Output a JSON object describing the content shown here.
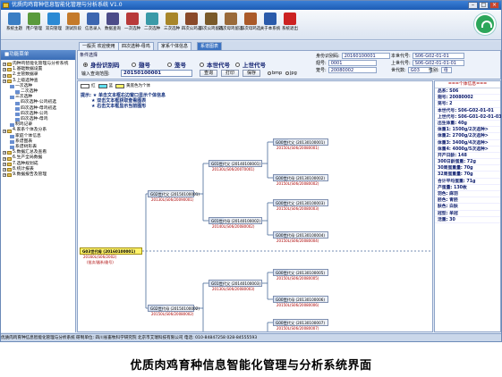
{
  "window": {
    "title": "优质肉鸡育种信息智能化管理与分析系统 V1.0"
  },
  "toolbar": [
    {
      "label": "系统主题",
      "color": "#3a7ec4",
      "icon": "theme-icon"
    },
    {
      "label": "用户管理",
      "color": "#5a9a3c",
      "icon": "users-icon"
    },
    {
      "label": "双向管理",
      "color": "#2c8ad4",
      "icon": "swap-icon"
    },
    {
      "label": "测试阶段",
      "color": "#c47a2a",
      "icon": "test-icon"
    },
    {
      "label": "信息录入",
      "color": "#3c66b0",
      "icon": "entry-icon"
    },
    {
      "label": "数据查询",
      "color": "#4c4c88",
      "icon": "query-icon"
    },
    {
      "label": "一次选种",
      "color": "#b83a3a",
      "icon": "select1-icon"
    },
    {
      "label": "二次选种",
      "color": "#3a9aa8",
      "icon": "select2-icon"
    },
    {
      "label": "三次选种",
      "color": "#a8862a",
      "icon": "select3-icon"
    },
    {
      "label": "四次公鸡选",
      "color": "#8a4a2a",
      "icon": "rooster-icon"
    },
    {
      "label": "四次公鸡留选",
      "color": "#7a5a2a",
      "icon": "rooster2-icon"
    },
    {
      "label": "四次母鸡留选",
      "color": "#9a6a3a",
      "icon": "hen-icon"
    },
    {
      "label": "四次母鸡选",
      "color": "#aa5a2a",
      "icon": "hen2-icon"
    },
    {
      "label": "关于本系统",
      "color": "#2a5aaa",
      "icon": "about-icon"
    },
    {
      "label": "系统退出",
      "color": "#cc2222",
      "icon": "exit-icon"
    }
  ],
  "tabs": [
    "一般页 欢迎使用",
    "四次选种-母鸡",
    "家系个体信息",
    "系谱图表"
  ],
  "sidebar": {
    "title": "■功能菜单",
    "items": [
      {
        "level": 1,
        "label": "肉种鸡智能化管理与分析系统"
      },
      {
        "level": 1,
        "label": "1.基础数据设置"
      },
      {
        "level": 1,
        "label": "2.主管数据录"
      },
      {
        "level": 1,
        "label": "3.上级选种查"
      },
      {
        "level": 2,
        "label": "一次选种"
      },
      {
        "level": 3,
        "label": "二次选种"
      },
      {
        "level": 2,
        "label": "三次选种"
      },
      {
        "level": 3,
        "label": "四次选种-公鸡初选"
      },
      {
        "level": 3,
        "label": "四次选种-母鸡初选"
      },
      {
        "level": 3,
        "label": "四次选种-公鸡"
      },
      {
        "level": 3,
        "label": "四次选种-母鸡"
      },
      {
        "level": 2,
        "label": "制鸡记录"
      },
      {
        "level": 1,
        "label": "4.家系个体及分系"
      },
      {
        "level": 2,
        "label": "家庭个体信息"
      },
      {
        "level": 2,
        "label": "系谱图表"
      },
      {
        "level": 2,
        "label": "系谱树形表"
      },
      {
        "level": 1,
        "label": "5.数据汇总及查看"
      },
      {
        "level": 1,
        "label": "6.生产全局数据"
      },
      {
        "level": 1,
        "label": "7.选种规划成"
      },
      {
        "level": 1,
        "label": "8.统计报表"
      },
      {
        "level": 1,
        "label": "9.数据报告及管理"
      }
    ]
  },
  "conditions": {
    "label": "条件选择",
    "radios": [
      {
        "label": "身份识别码",
        "selected": true
      },
      {
        "label": "翅号",
        "selected": false
      },
      {
        "label": "笼号",
        "selected": false
      },
      {
        "label": "本世代号",
        "selected": false
      },
      {
        "label": "上世代号",
        "selected": false
      }
    ],
    "query_label": "输入查询范围:",
    "query_value": "20150100001",
    "query_button": "查询",
    "print_button": "打印",
    "save_button": "保存",
    "image_opts": [
      "bmp",
      "jpg"
    ],
    "info": [
      {
        "label": "身份识别码:",
        "value": "20160100001"
      },
      {
        "label": "翅号:",
        "value": "0001"
      },
      {
        "label": "笼号:",
        "value": "20080002"
      },
      {
        "label": "本世代号:",
        "value": "S06-G02-01-01"
      },
      {
        "label": "上世代号:",
        "value": "S06-G02-01-01-01"
      },
      {
        "label": "世代数:",
        "value": "G03"
      },
      {
        "label": "性别:",
        "value": "母"
      }
    ]
  },
  "pedigree": {
    "legend": [
      "红",
      "蓝",
      "黄底色为个体"
    ],
    "legend_colors": [
      "#ffffff",
      "#5fe0f0",
      "#fff36b"
    ],
    "hints": [
      "提示: ★ 单击文本框右边窗口显示个体信息",
      "★ 双击文本框获取查看图表",
      "★ 右击文本框显示当前图形"
    ],
    "root": {
      "label": "G03世代母 (20160100001)",
      "sub1": "20160L(S06/2002)",
      "sub2": "(批次/器系/翅号)"
    },
    "g2": [
      {
        "label": "G02世代父 (20150100001)",
        "sub1": "20130L(S06/20090001)"
      },
      {
        "label": "G02世代母 (20150100002)",
        "sub1": "20150L(S06/20080002)"
      }
    ],
    "g1": [
      {
        "label": "G01世代父 (20140100001)",
        "sub1": "20130L(S06/20070001)"
      },
      {
        "label": "G01世代母 (20140100002)",
        "sub1": "20140L(S06/20080002)"
      },
      {
        "label": "G01世代父 (20140100003)",
        "sub1": "20130L(S06/20080003)"
      },
      {
        "label": "G01世代母 (20140100004)",
        "sub1": "20150L(S06/20070004)"
      }
    ],
    "g0": [
      {
        "label": "G00世代父 (20130100001)",
        "sub1": "20150L(S06/20080001)"
      },
      {
        "label": "G00世代母 (20130100002)",
        "sub1": "20150L(S06/20080002)"
      },
      {
        "label": "G00世代父 (20130100003)",
        "sub1": "20150L(S06/20080003)"
      },
      {
        "label": "G00世代母 (20130100004)",
        "sub1": "20150L(S06/20080004)"
      },
      {
        "label": "G00世代父 (20130100005)",
        "sub1": "20150L(S06/20080005)"
      },
      {
        "label": "G00世代母 (20130100006)",
        "sub1": "20150L(S06/20080006)"
      },
      {
        "label": "G00世代父 (20130100007)",
        "sub1": "20150L(S06/20080007)"
      },
      {
        "label": "G00世代母 (20130100008)",
        "sub1": "20150L(S06/20080008)"
      }
    ]
  },
  "detail": {
    "header": "===个体信息===",
    "rows": [
      "品系: S06",
      "翅号: 20080002",
      "笼号: 2",
      "本世代号: S06-G02-01-01",
      "上世代号: S06-G01-02-01-03",
      "出生体重: 40g",
      "体重1: 1500g/2次选种>",
      "体重2: 2700g/2次选种>",
      "体重3: 3400g/4次选种>",
      "体重4: 4000g/5次选种>",
      "开产日龄: 148",
      "300日龄蛋重: 72g",
      "30周蛋重量: 70g",
      "32周蛋重量: 70g",
      "合计平均蛋重: 71g",
      "产蛋量: 130枚",
      "羽色: 麻羽",
      "胫色: 青胫",
      "肤色: 白肤",
      "冠型: 单冠",
      "活重: 30"
    ]
  },
  "status": {
    "text": "优质肉鸡育种信息智能化管理与分析系统       研制单位: 四川省畜牧科学研究院  北京市艾瑞科技有限公司    电话: 010-84847258 028-84555593"
  },
  "caption": "优质肉鸡育种信息智能化管理与分析系统界面"
}
